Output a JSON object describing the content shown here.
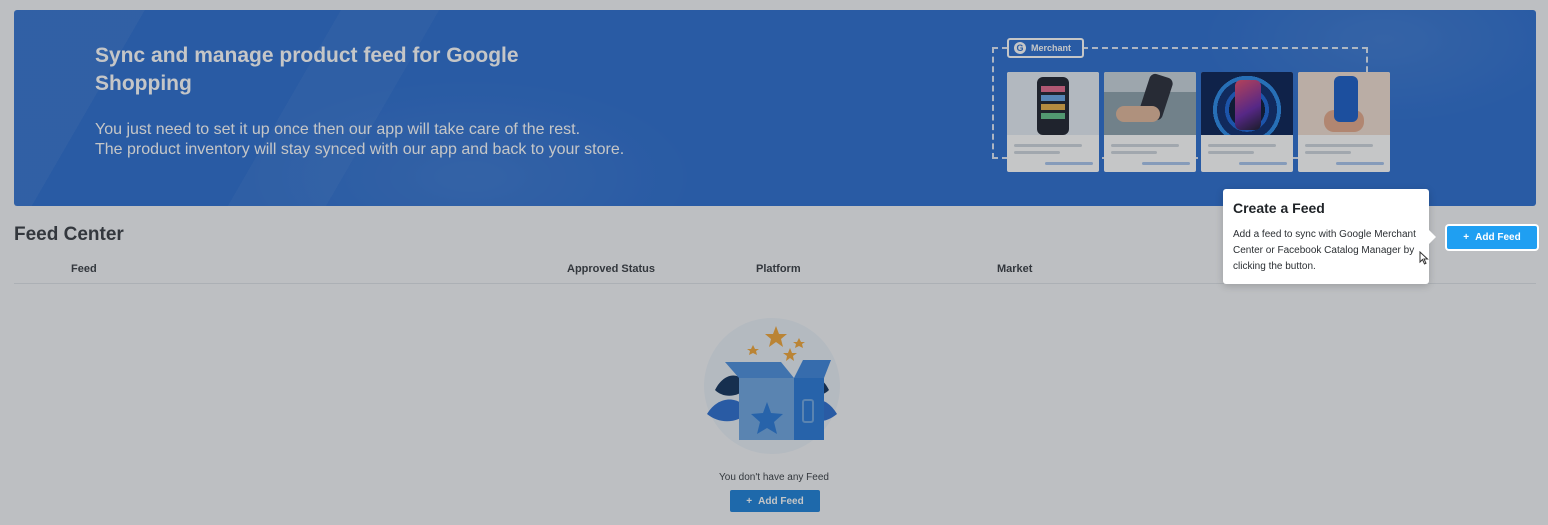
{
  "banner": {
    "title": "Sync and manage product feed for Google Shopping",
    "description_line1": "You just need to set it up once then our app will take care of the rest.",
    "description_line2": "The product inventory will stay synced with our app and back to your store.",
    "merchant_tag": "Merchant",
    "merchant_icon": "google-g-icon"
  },
  "feed_center": {
    "title": "Feed Center",
    "add_feed_label": "Add Feed",
    "columns": [
      "Feed",
      "Approved Status",
      "Platform",
      "Market"
    ]
  },
  "empty_state": {
    "message": "You don't have any Feed",
    "button_label": "Add Feed",
    "icon": "empty-gift-box-illustration"
  },
  "tooltip": {
    "title": "Create a Feed",
    "body": "Add a feed to sync with Google Merchant Center or Facebook Catalog Manager by clicking the button."
  },
  "colors": {
    "banner": "#2d6fd0",
    "primary_button": "#1f9ff2",
    "secondary_button": "#1e82d9"
  }
}
